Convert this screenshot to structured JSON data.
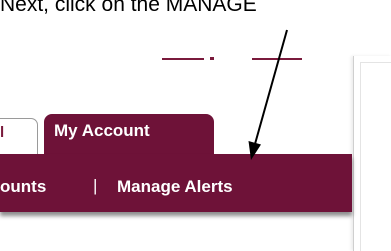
{
  "instruction": {
    "text": "Next, click on the MANAGE"
  },
  "tabs": [
    {
      "label": "l",
      "active": false
    },
    {
      "label": "My Account",
      "active": true
    }
  ],
  "menu": {
    "items": [
      {
        "label": "ounts"
      },
      {
        "label": "Manage Alerts"
      }
    ],
    "separator": "|"
  },
  "colors": {
    "brand": "#6e1238",
    "accent_strip": "#7a1a3c",
    "text_on_brand": "#ffffff",
    "annotation": "#000000"
  },
  "icons": {
    "annotation_arrow": "arrow-pointer-icon"
  }
}
